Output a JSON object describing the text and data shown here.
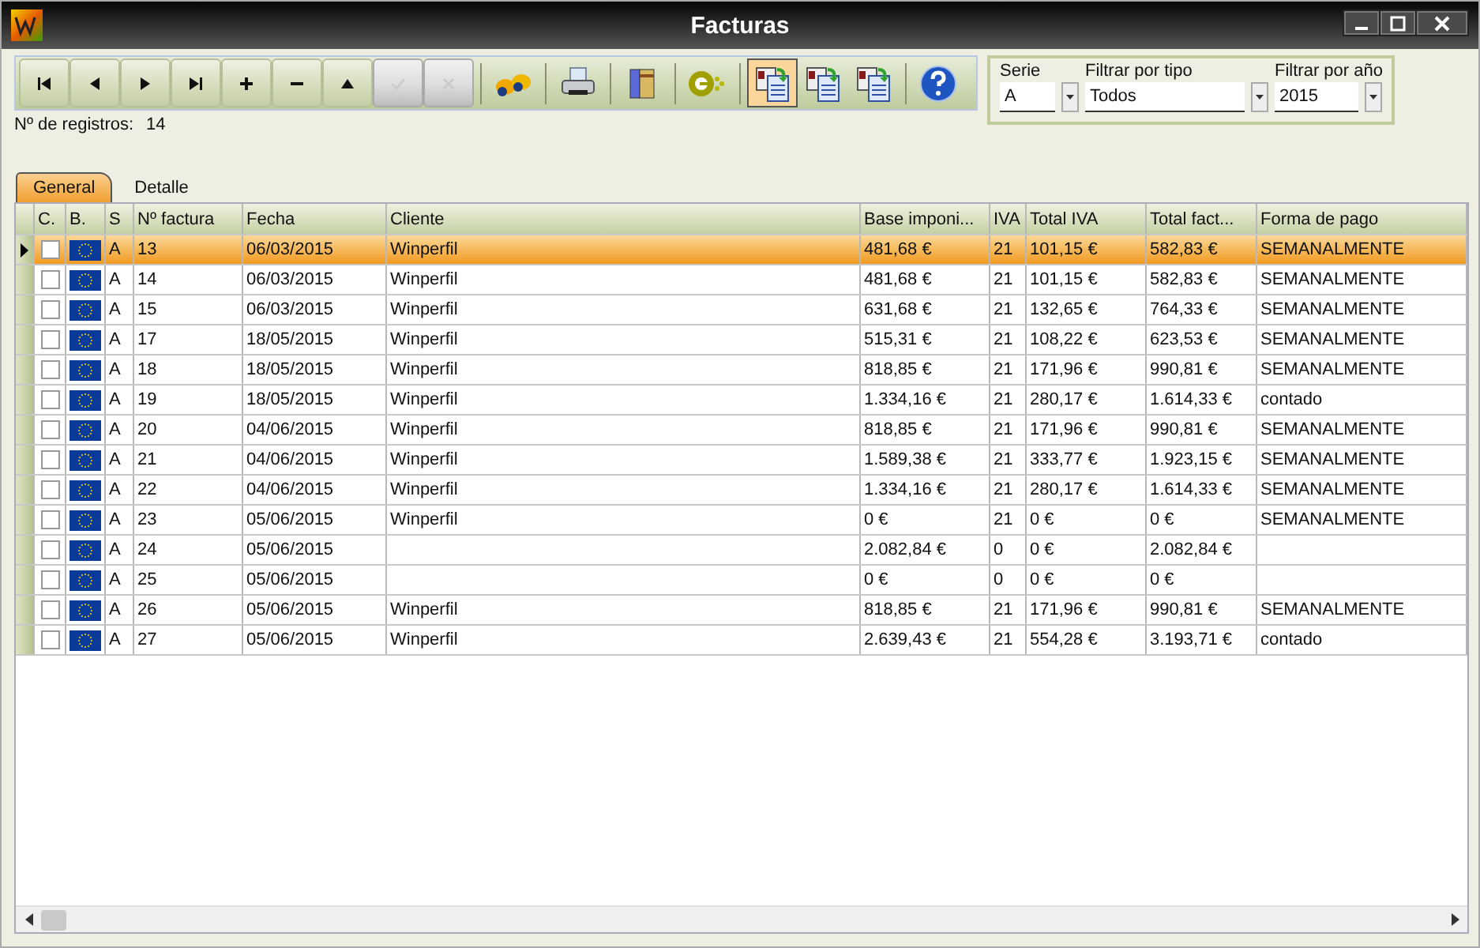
{
  "window": {
    "title": "Facturas"
  },
  "toolbar": [
    {
      "kind": "first",
      "disabled": false,
      "selected": false
    },
    {
      "kind": "prev",
      "disabled": false,
      "selected": false
    },
    {
      "kind": "next",
      "disabled": false,
      "selected": false
    },
    {
      "kind": "last",
      "disabled": false,
      "selected": false
    },
    {
      "kind": "add",
      "disabled": false,
      "selected": false
    },
    {
      "kind": "remove",
      "disabled": false,
      "selected": false
    },
    {
      "kind": "up",
      "disabled": false,
      "selected": false
    },
    {
      "kind": "confirm",
      "disabled": true,
      "selected": false
    },
    {
      "kind": "cancel",
      "disabled": true,
      "selected": false
    },
    {
      "kind": "binoculars",
      "disabled": false,
      "selected": false
    },
    {
      "kind": "printer",
      "disabled": false,
      "selected": false
    },
    {
      "kind": "books",
      "disabled": false,
      "selected": false
    },
    {
      "kind": "elogo",
      "disabled": false,
      "selected": false
    },
    {
      "kind": "docp",
      "disabled": false,
      "selected": true
    },
    {
      "kind": "doca",
      "disabled": false,
      "selected": false
    },
    {
      "kind": "docr",
      "disabled": false,
      "selected": false
    },
    {
      "kind": "help",
      "disabled": false,
      "selected": false
    }
  ],
  "filters": [
    {
      "label": "Serie",
      "value": "A"
    },
    {
      "label": "Filtrar por tipo",
      "value": "Todos"
    },
    {
      "label": "Filtrar por año",
      "value": "2015"
    }
  ],
  "records": {
    "label": "Nº de registros:",
    "value": "14"
  },
  "tabs": [
    {
      "label": "General",
      "selected": true
    },
    {
      "label": "Detalle",
      "selected": false
    }
  ],
  "table": {
    "columns": [
      "C.",
      "B.",
      "S",
      "Nº factura",
      "Fecha",
      "Cliente",
      "Base imponi...",
      "IVA",
      "Total IVA",
      "Total fact...",
      "Forma de pago"
    ],
    "rows": [
      {
        "selected": true,
        "checked": false,
        "serie": "A",
        "numero": "13",
        "fecha": "06/03/2015",
        "cliente": "Winperfil",
        "base": "481,68 €",
        "iva": "21",
        "total_iva": "101,15 €",
        "total": "582,83 €",
        "pago": "SEMANALMENTE"
      },
      {
        "selected": false,
        "checked": false,
        "serie": "A",
        "numero": "14",
        "fecha": "06/03/2015",
        "cliente": "Winperfil",
        "base": "481,68 €",
        "iva": "21",
        "total_iva": "101,15 €",
        "total": "582,83 €",
        "pago": "SEMANALMENTE"
      },
      {
        "selected": false,
        "checked": false,
        "serie": "A",
        "numero": "15",
        "fecha": "06/03/2015",
        "cliente": "Winperfil",
        "base": "631,68 €",
        "iva": "21",
        "total_iva": "132,65 €",
        "total": "764,33 €",
        "pago": "SEMANALMENTE"
      },
      {
        "selected": false,
        "checked": false,
        "serie": "A",
        "numero": "17",
        "fecha": "18/05/2015",
        "cliente": "Winperfil",
        "base": "515,31 €",
        "iva": "21",
        "total_iva": "108,22 €",
        "total": "623,53 €",
        "pago": "SEMANALMENTE"
      },
      {
        "selected": false,
        "checked": false,
        "serie": "A",
        "numero": "18",
        "fecha": "18/05/2015",
        "cliente": "Winperfil",
        "base": "818,85 €",
        "iva": "21",
        "total_iva": "171,96 €",
        "total": "990,81 €",
        "pago": "SEMANALMENTE"
      },
      {
        "selected": false,
        "checked": false,
        "serie": "A",
        "numero": "19",
        "fecha": "18/05/2015",
        "cliente": "Winperfil",
        "base": "1.334,16 €",
        "iva": "21",
        "total_iva": "280,17 €",
        "total": "1.614,33 €",
        "pago": "contado"
      },
      {
        "selected": false,
        "checked": false,
        "serie": "A",
        "numero": "20",
        "fecha": "04/06/2015",
        "cliente": "Winperfil",
        "base": "818,85 €",
        "iva": "21",
        "total_iva": "171,96 €",
        "total": "990,81 €",
        "pago": "SEMANALMENTE"
      },
      {
        "selected": false,
        "checked": false,
        "serie": "A",
        "numero": "21",
        "fecha": "04/06/2015",
        "cliente": "Winperfil",
        "base": "1.589,38 €",
        "iva": "21",
        "total_iva": "333,77 €",
        "total": "1.923,15 €",
        "pago": "SEMANALMENTE"
      },
      {
        "selected": false,
        "checked": false,
        "serie": "A",
        "numero": "22",
        "fecha": "04/06/2015",
        "cliente": "Winperfil",
        "base": "1.334,16 €",
        "iva": "21",
        "total_iva": "280,17 €",
        "total": "1.614,33 €",
        "pago": "SEMANALMENTE"
      },
      {
        "selected": false,
        "checked": false,
        "serie": "A",
        "numero": "23",
        "fecha": "05/06/2015",
        "cliente": "Winperfil",
        "base": "0 €",
        "iva": "21",
        "total_iva": "0 €",
        "total": "0 €",
        "pago": "SEMANALMENTE"
      },
      {
        "selected": false,
        "checked": false,
        "serie": "A",
        "numero": "24",
        "fecha": "05/06/2015",
        "base": "2.082,84 €",
        "iva": "0",
        "total_iva": "0 €",
        "total": "2.082,84 €"
      },
      {
        "selected": false,
        "checked": false,
        "serie": "A",
        "numero": "25",
        "fecha": "05/06/2015",
        "base": "0 €",
        "iva": "0",
        "total_iva": "0 €",
        "total": "0 €"
      },
      {
        "selected": false,
        "checked": false,
        "serie": "A",
        "numero": "26",
        "fecha": "05/06/2015",
        "cliente": "Winperfil",
        "base": "818,85 €",
        "iva": "21",
        "total_iva": "171,96 €",
        "total": "990,81 €",
        "pago": "SEMANALMENTE"
      },
      {
        "selected": false,
        "checked": false,
        "serie": "A",
        "numero": "27",
        "fecha": "05/06/2015",
        "cliente": "Winperfil",
        "base": "2.639,43 €",
        "iva": "21",
        "total_iva": "554,28 €",
        "total": "3.193,71 €",
        "pago": "contado"
      }
    ]
  }
}
